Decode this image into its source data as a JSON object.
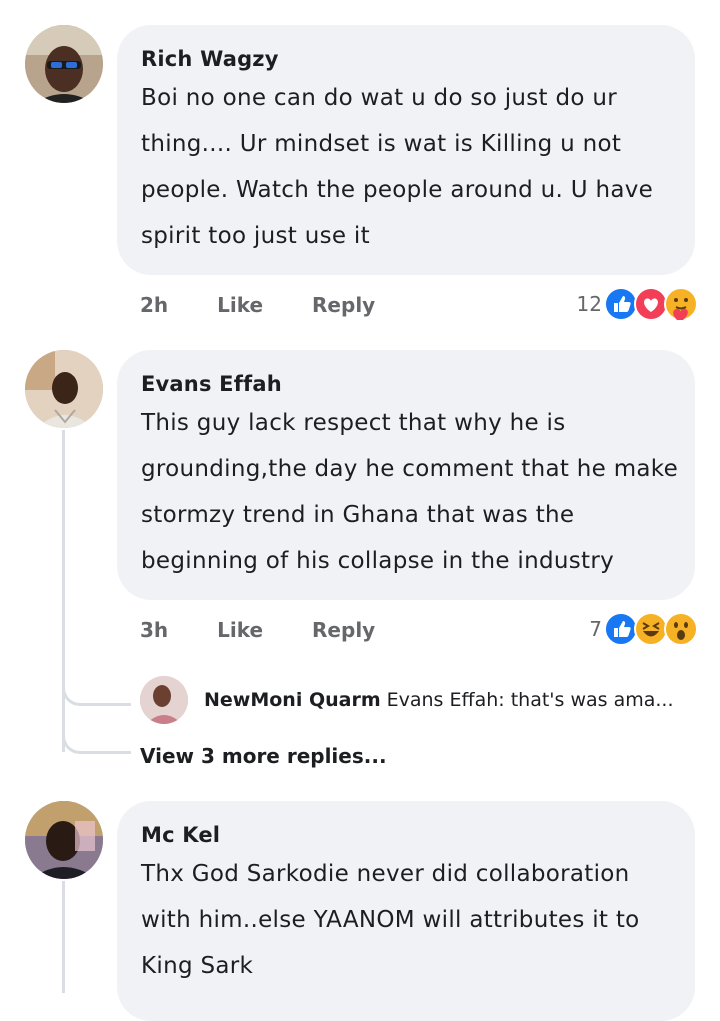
{
  "comments": [
    {
      "author": "Rich Wagzy",
      "text": "Boi no one can do wat u do so  just do ur thing.... Ur mindset is wat is Killing u not people. Watch the people around u. U have spirit too  just use it",
      "time": "2h",
      "like": "Like",
      "reply": "Reply",
      "reaction_count": "12",
      "reactions": [
        "like-icon",
        "love-icon",
        "care-icon"
      ]
    },
    {
      "author": "Evans Effah",
      "text": "This guy lack respect that why he is grounding,the day he comment that he make stormzy trend in Ghana that was the beginning of his collapse in the industry",
      "time": "3h",
      "like": "Like",
      "reply": "Reply",
      "reaction_count": "7",
      "reactions": [
        "like-icon",
        "haha-icon",
        "wow-icon"
      ],
      "reply_preview": {
        "author": "NewMoni Quarm",
        "text": "Evans Effah: that's was ama..."
      },
      "view_more": "View 3 more replies..."
    },
    {
      "author": "Mc Kel",
      "text": "Thx God Sarkodie never did collaboration with him..else YAANOM will attributes it to King Sark"
    }
  ],
  "colors": {
    "bubble": "#f0f2f5",
    "like_blue": "#1877f2",
    "love_red": "#f33e58",
    "emoji_yellow": "#f7b125"
  }
}
